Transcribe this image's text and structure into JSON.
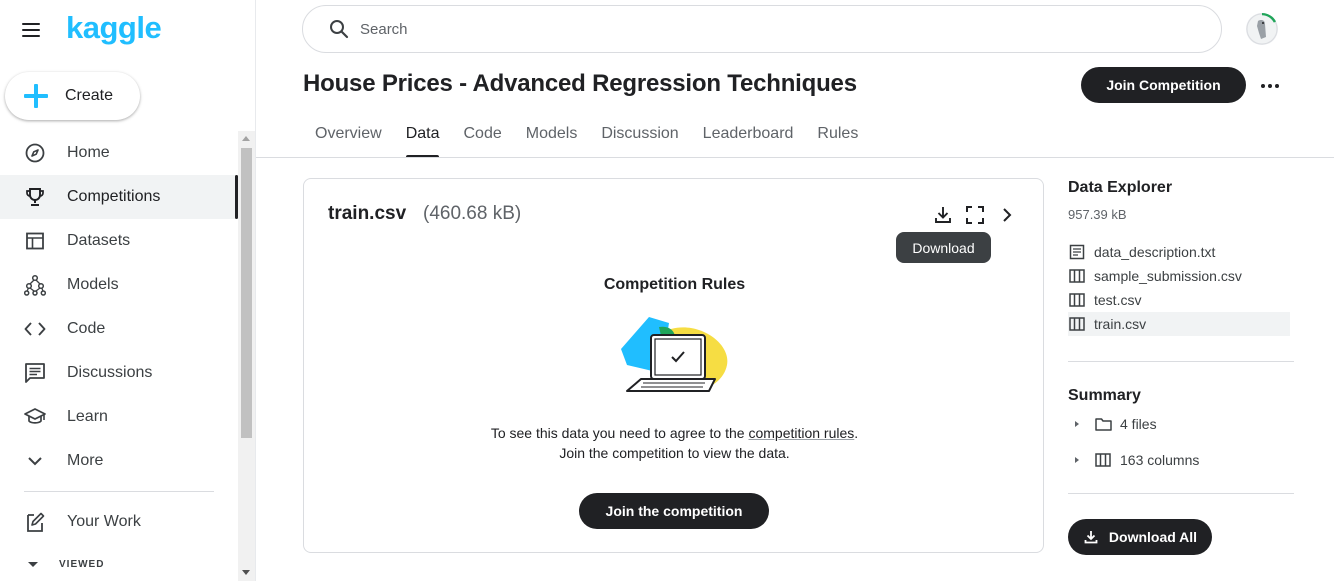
{
  "brand": {
    "logo": "kaggle",
    "accent": "#20beff"
  },
  "sidebar": {
    "create_label": "Create",
    "items": [
      {
        "label": "Home",
        "icon": "compass-icon"
      },
      {
        "label": "Competitions",
        "icon": "trophy-icon",
        "active": true
      },
      {
        "label": "Datasets",
        "icon": "table-icon"
      },
      {
        "label": "Models",
        "icon": "models-icon"
      },
      {
        "label": "Code",
        "icon": "code-icon"
      },
      {
        "label": "Discussions",
        "icon": "discussion-icon"
      },
      {
        "label": "Learn",
        "icon": "school-icon"
      },
      {
        "label": "More",
        "icon": "chevron-down-icon"
      }
    ],
    "your_work": "Your Work",
    "viewed": "VIEWED"
  },
  "search": {
    "placeholder": "Search"
  },
  "header": {
    "title": "House Prices - Advanced Regression Techniques",
    "join_button": "Join Competition"
  },
  "tabs": [
    "Overview",
    "Data",
    "Code",
    "Models",
    "Discussion",
    "Leaderboard",
    "Rules"
  ],
  "active_tab": "Data",
  "card": {
    "file_name": "train.csv",
    "file_size": "(460.68 kB)",
    "tooltip": "Download",
    "rules_title": "Competition Rules",
    "rules_text_before": "To see this data you need to agree to the ",
    "rules_link": "competition rules",
    "rules_text_after": ".",
    "rules_text_line2": "Join the competition to view the data.",
    "join_button": "Join the competition"
  },
  "explorer": {
    "title": "Data Explorer",
    "size": "957.39 kB",
    "files": [
      {
        "name": "data_description.txt",
        "icon": "document-icon"
      },
      {
        "name": "sample_submission.csv",
        "icon": "table-columns-icon"
      },
      {
        "name": "test.csv",
        "icon": "table-columns-icon"
      },
      {
        "name": "train.csv",
        "icon": "table-columns-icon",
        "active": true
      }
    ]
  },
  "summary": {
    "title": "Summary",
    "files": "4 files",
    "columns": "163 columns",
    "download_all": "Download All"
  }
}
